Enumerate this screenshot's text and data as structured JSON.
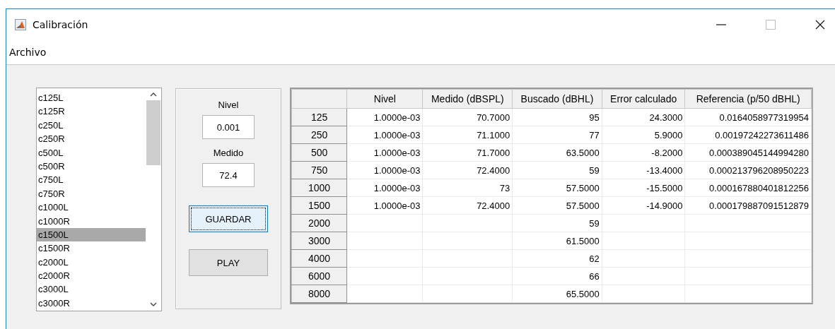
{
  "window": {
    "title": "Calibración"
  },
  "menu": [
    "Archivo"
  ],
  "list": {
    "items": [
      {
        "label": "c125L",
        "selected": false
      },
      {
        "label": "c125R",
        "selected": false
      },
      {
        "label": "c250L",
        "selected": false
      },
      {
        "label": "c250R",
        "selected": false
      },
      {
        "label": "c500L",
        "selected": false
      },
      {
        "label": "c500R",
        "selected": false
      },
      {
        "label": "c750L",
        "selected": false
      },
      {
        "label": "c750R",
        "selected": false
      },
      {
        "label": "c1000L",
        "selected": false
      },
      {
        "label": "c1000R",
        "selected": false
      },
      {
        "label": "c1500L",
        "selected": true
      },
      {
        "label": "c1500R",
        "selected": false
      },
      {
        "label": "c2000L",
        "selected": false
      },
      {
        "label": "c2000R",
        "selected": false
      },
      {
        "label": "c3000L",
        "selected": false
      },
      {
        "label": "c3000R",
        "selected": false
      }
    ]
  },
  "controls": {
    "nivel_label": "Nivel",
    "nivel_value": "0.001",
    "medido_label": "Medido",
    "medido_value": "72.4",
    "buttons": [
      {
        "label": "GUARDAR",
        "focused": true
      },
      {
        "label": "PLAY",
        "focused": false
      }
    ]
  },
  "table": {
    "columns": [
      "Nivel",
      "Medido (dBSPL)",
      "Buscado (dBHL)",
      "Error calculado",
      "Referencia (p/50 dBHL)"
    ],
    "rows": [
      {
        "header": "125",
        "cells": [
          "1.0000e-03",
          "70.7000",
          "95",
          "24.3000",
          "0.0164058977319954"
        ]
      },
      {
        "header": "250",
        "cells": [
          "1.0000e-03",
          "71.1000",
          "77",
          "5.9000",
          "0.00197242273611486"
        ]
      },
      {
        "header": "500",
        "cells": [
          "1.0000e-03",
          "71.7000",
          "63.5000",
          "-8.2000",
          "0.000389045144994280"
        ]
      },
      {
        "header": "750",
        "cells": [
          "1.0000e-03",
          "72.4000",
          "59",
          "-13.4000",
          "0.000213796208950223"
        ]
      },
      {
        "header": "1000",
        "cells": [
          "1.0000e-03",
          "73",
          "57.5000",
          "-15.5000",
          "0.000167880401812256"
        ]
      },
      {
        "header": "1500",
        "cells": [
          "1.0000e-03",
          "72.4000",
          "57.5000",
          "-14.9000",
          "0.000179887091512879"
        ]
      },
      {
        "header": "2000",
        "cells": [
          null,
          null,
          "59",
          null,
          null
        ]
      },
      {
        "header": "3000",
        "cells": [
          null,
          null,
          "61.5000",
          null,
          null
        ]
      },
      {
        "header": "4000",
        "cells": [
          null,
          null,
          "62",
          null,
          null
        ]
      },
      {
        "header": "6000",
        "cells": [
          null,
          null,
          "66",
          null,
          null
        ]
      },
      {
        "header": "8000",
        "cells": [
          null,
          null,
          "65.5000",
          null,
          null
        ]
      }
    ]
  }
}
